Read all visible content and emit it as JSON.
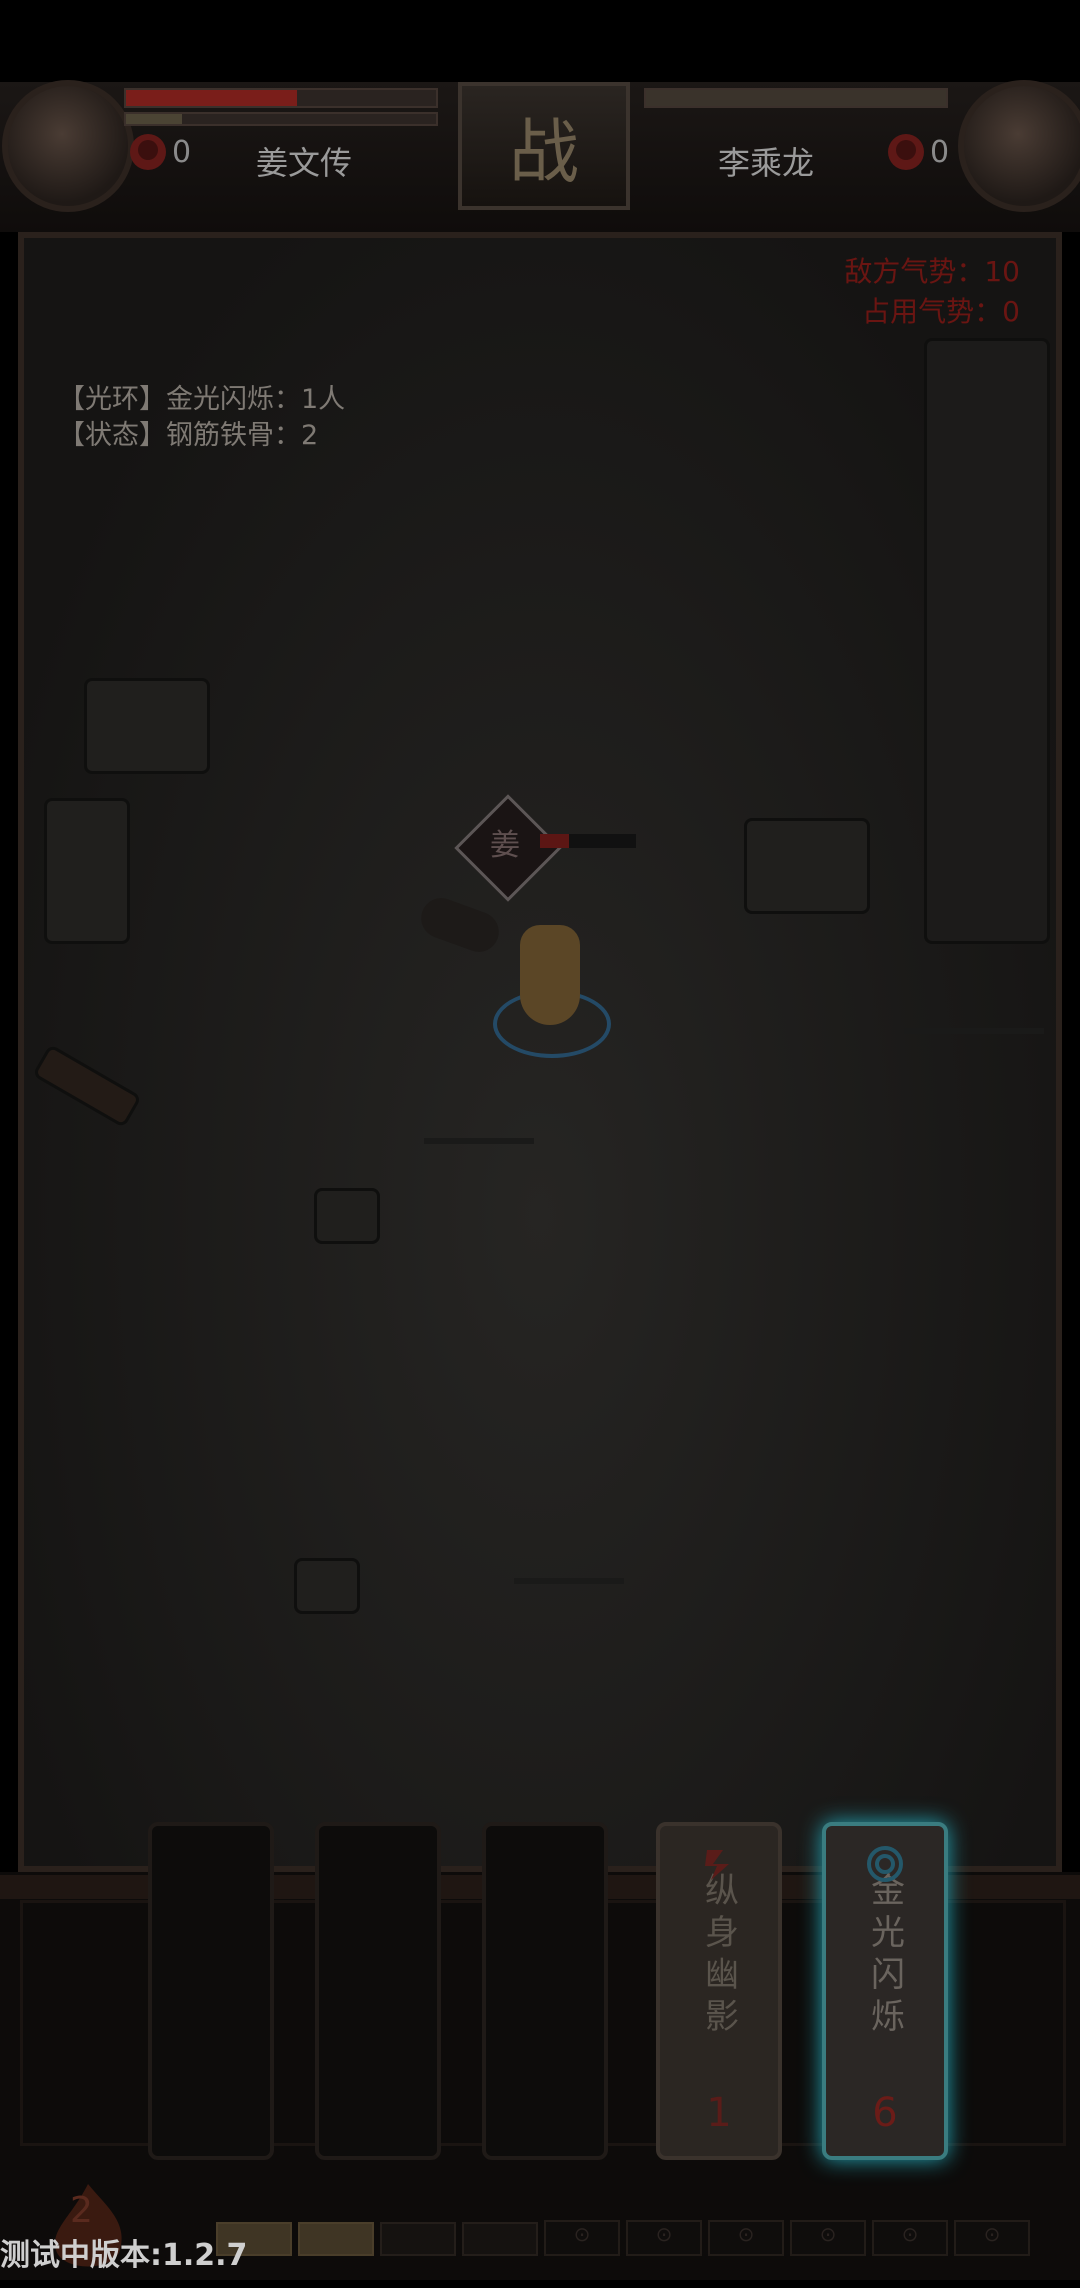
{
  "header": {
    "battle_icon": "战",
    "left_player": {
      "name": "姜文传",
      "kills": "0",
      "hp_fraction": 0.55
    },
    "right_player": {
      "name": "李乘龙",
      "kills": "0",
      "hp_fraction": 1.0
    }
  },
  "enemy_info": {
    "enemy_qi": "敌方气势：10",
    "occupied_qi": "占用气势：0"
  },
  "buffs": {
    "aura": "【光环】金光闪烁：1人",
    "status": "【状态】钢筋铁骨：2"
  },
  "character": {
    "tag": "姜",
    "hp_fraction": 0.3
  },
  "skills": [
    {
      "name": "",
      "count": "",
      "state": "disabled"
    },
    {
      "name": "",
      "count": "",
      "state": "disabled"
    },
    {
      "name": "",
      "count": "",
      "state": "disabled"
    },
    {
      "name": "纵身幽影",
      "count": "1",
      "state": "ready",
      "icon": "dash-icon"
    },
    {
      "name": "金光闪烁",
      "count": "6",
      "state": "selected",
      "icon": "ring-icon"
    }
  ],
  "energy": {
    "value": "2",
    "filled_slots": 2,
    "total_open_slots": 4,
    "locked_slots": 6
  },
  "version_text": "测试中版本:1.2.7",
  "colors": {
    "glow": "#24a3b3",
    "hp_red": "#7a1e1a",
    "enemy_text": "#6a1512"
  }
}
